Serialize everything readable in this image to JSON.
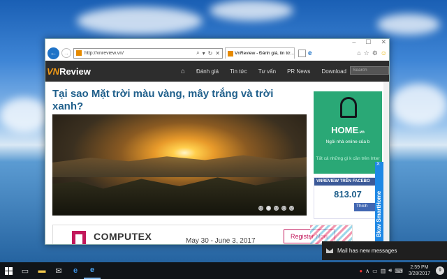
{
  "browser": {
    "address_url": "http://vnreview.vn/",
    "tab_title": "VnReview - Đánh giá, tin tứ...",
    "window_controls": [
      "minimize-icon",
      "maximize-icon",
      "close-icon"
    ]
  },
  "site": {
    "logo_prefix": "VN",
    "logo_text": "Review",
    "nav_items": [
      "Đánh giá",
      "Tin tức",
      "Tư vấn",
      "PR News",
      "Download"
    ],
    "search_placeholder": "Search"
  },
  "article": {
    "title": "Tại sao Mặt trời màu vàng, mây trắng và trời xanh?",
    "slide_dots": [
      "1",
      "2",
      "3",
      "4",
      "5"
    ],
    "active_slide": 1
  },
  "ads": {
    "home_title": "HOME",
    "home_title_suffix": ".vn",
    "home_sub": "Ngôi nhà online của b",
    "home_note": "Tất cả những gì k cần trên Inter",
    "computex_name": "COMPUTEX",
    "computex_date": "May 30 - June 3, 2017",
    "register_label": "Register Now"
  },
  "facebook": {
    "header": "VNREVIEW TRÊN FACEBO",
    "count": "813.07",
    "like_label": "Thích"
  },
  "bkav": {
    "label": "Bkav SmartHome",
    "close": "X"
  },
  "notification": {
    "text": "Mail has new messages"
  },
  "taskbar": {
    "time": "2:59 PM",
    "date": "3/28/2017",
    "notif_count": "9"
  },
  "colors": {
    "site_nav_bg": "#2d2d2d",
    "title_blue": "#1f5f8b",
    "home_green": "#2aa876",
    "fb_blue": "#3b5998",
    "computex_magenta": "#c2185b"
  }
}
